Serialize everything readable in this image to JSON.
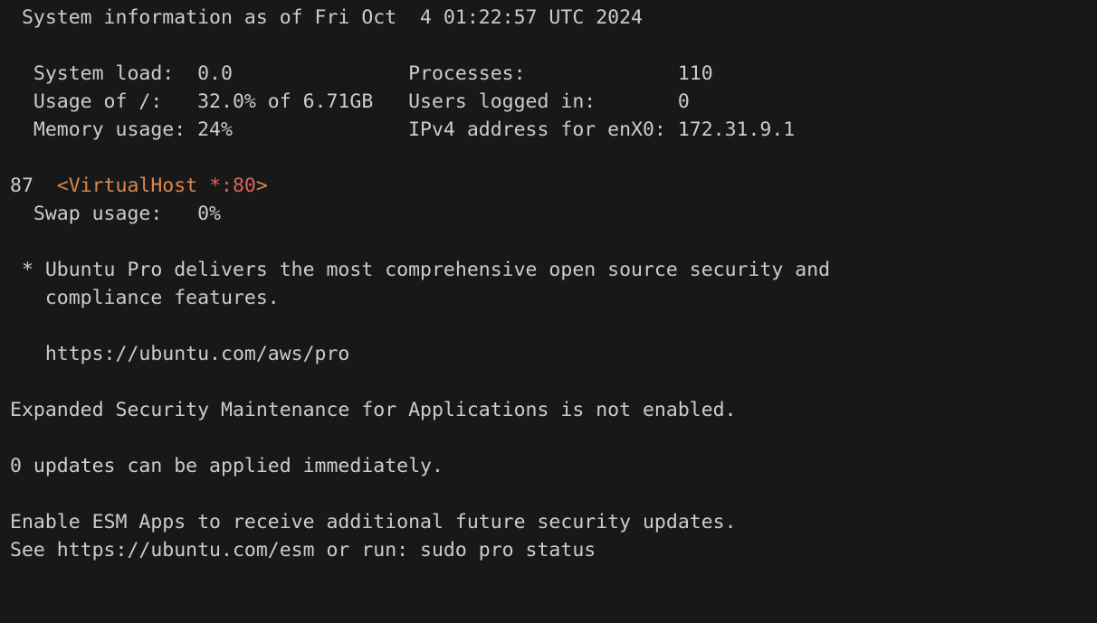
{
  "terminal": {
    "lines": [
      " System information as of Fri Oct  4 01:22:57 UTC 2024",
      "",
      "  System load:  0.0               Processes:             110",
      "  Usage of /:   32.0% of 6.71GB   Users logged in:       0",
      "  Memory usage: 24%               IPv4 address for enX0: 172.31.9.1",
      "",
      "87",
      "  Swap usage:   0%",
      "",
      " * Ubuntu Pro delivers the most comprehensive open source security and",
      "   compliance features.",
      "",
      "   https://ubuntu.com/aws/pro",
      "",
      "Expanded Security Maintenance for Applications is not enabled.",
      "",
      "0 updates can be applied immediately.",
      "",
      "Enable ESM Apps to receive additional future security updates.",
      "See https://ubuntu.com/esm or run: sudo pro status"
    ],
    "virtualhost": {
      "open": "<VirtualHost ",
      "attr": "*:80",
      "close": ">"
    },
    "colors": {
      "background": "#181818",
      "foreground": "#cccccc",
      "tag": "#d8884f",
      "attr": "#e06060"
    }
  }
}
